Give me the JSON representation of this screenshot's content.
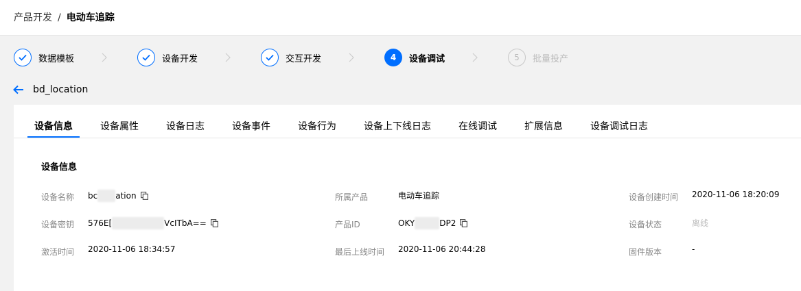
{
  "breadcrumb": {
    "parent": "产品开发",
    "separator": "/",
    "current": "电动车追踪"
  },
  "steps": [
    {
      "label": "数据模板",
      "state": "done",
      "number": ""
    },
    {
      "label": "设备开发",
      "state": "done",
      "number": ""
    },
    {
      "label": "交互开发",
      "state": "done",
      "number": ""
    },
    {
      "label": "设备调试",
      "state": "active",
      "number": "4"
    },
    {
      "label": "批量投产",
      "state": "todo",
      "number": "5"
    }
  ],
  "device_title": "bd_location",
  "tabs": [
    "设备信息",
    "设备属性",
    "设备日志",
    "设备事件",
    "设备行为",
    "设备上下线日志",
    "在线调试",
    "扩展信息",
    "设备调试日志"
  ],
  "active_tab": "设备信息",
  "section_title": "设备信息",
  "info": {
    "device_name_label": "设备名称",
    "device_name_prefix": "bc",
    "device_name_suffix": "ation",
    "device_secret_label": "设备密钥",
    "device_secret_prefix": "576E[",
    "device_secret_suffix": "VcITbA==",
    "activation_time_label": "激活时间",
    "activation_time": "2020-11-06 18:34:57",
    "product_label": "所属产品",
    "product": "电动车追踪",
    "product_id_label": "产品ID",
    "product_id_prefix": "OKY",
    "product_id_suffix": "DP2",
    "last_online_label": "最后上线时间",
    "last_online": "2020-11-06 20:44:28",
    "created_label": "设备创建时间",
    "created": "2020-11-06 18:20:09",
    "status_label": "设备状态",
    "status": "离线",
    "firmware_label": "固件版本",
    "firmware": "-"
  },
  "colors": {
    "accent": "#006eff",
    "muted": "#bbbbbb",
    "label": "#888888"
  }
}
